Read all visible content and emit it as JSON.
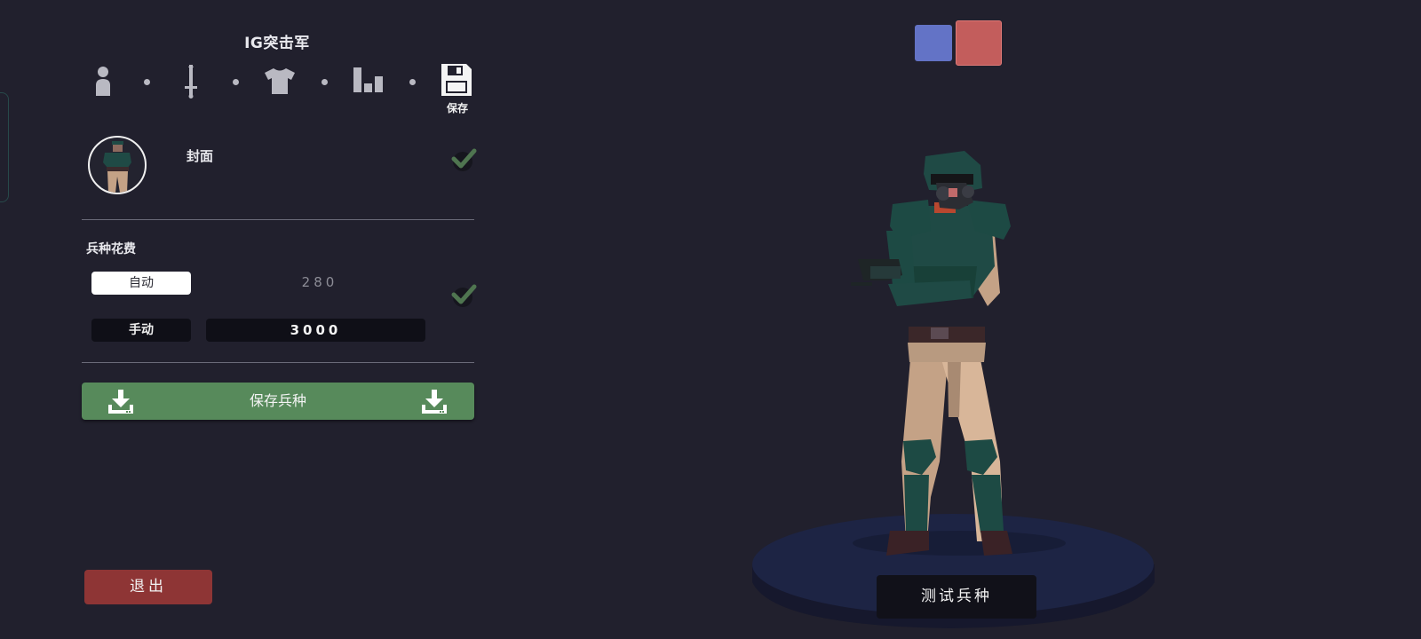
{
  "editor": {
    "title": "IG突击军",
    "steps": [
      {
        "icon": "person-icon"
      },
      {
        "icon": "sword-icon"
      },
      {
        "icon": "shirt-icon"
      },
      {
        "icon": "bar-chart-icon"
      },
      {
        "icon": "floppy-disk-icon",
        "label": "保存"
      }
    ]
  },
  "cover": {
    "label": "封面",
    "checked": true
  },
  "cost": {
    "heading": "兵种花费",
    "auto_label": "自动",
    "auto_value": "280",
    "manual_label": "手动",
    "manual_value": "3000",
    "checked": true
  },
  "actions": {
    "save_unit_label": "保存兵种",
    "exit_label": "退出",
    "test_unit_label": "测试兵种"
  },
  "teams": {
    "blue": "#6373c6",
    "red": "#c35d5c"
  },
  "colors": {
    "background": "#21202d",
    "save_green": "#578a5b",
    "exit_red": "#8e3535"
  }
}
